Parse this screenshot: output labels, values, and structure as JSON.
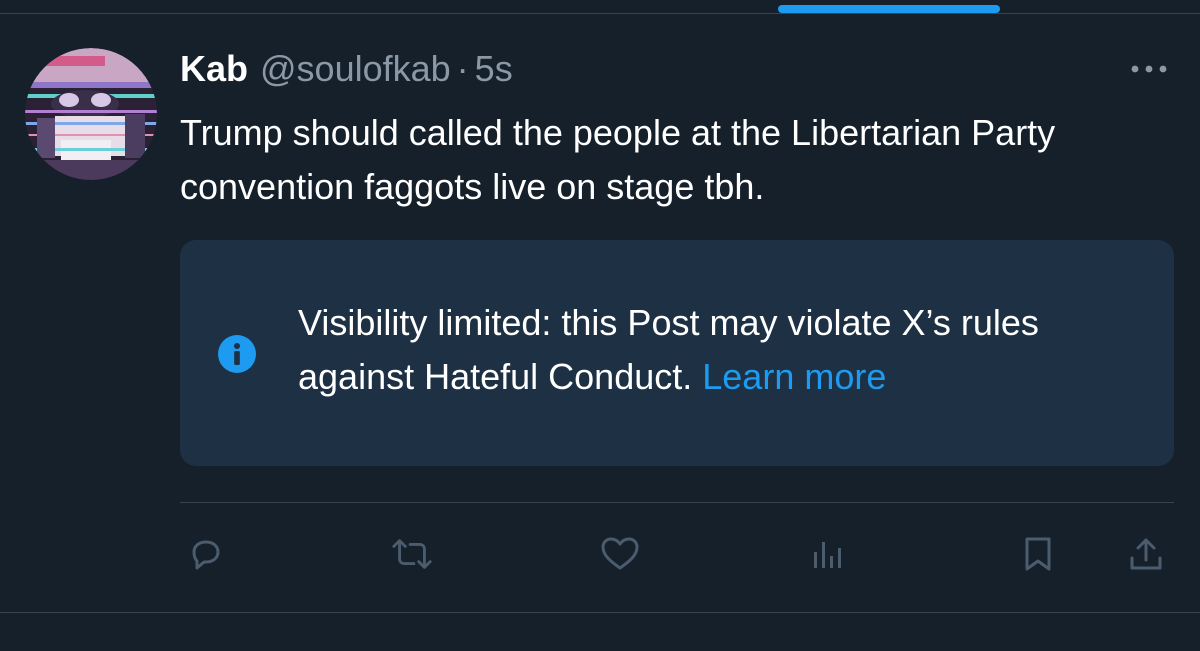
{
  "tweet": {
    "author_name": "Kab",
    "handle": "@soulofkab",
    "separator": "·",
    "time": "5s",
    "text": "Trump should called the people at the Libertarian Party convention faggots live on stage tbh."
  },
  "notice": {
    "text": "Visibility limited: this Post may violate X’s rules against Hateful Conduct.",
    "link_label": "Learn more",
    "icon": "info-icon"
  },
  "actions": {
    "reply_icon": "reply-icon",
    "repost_icon": "repost-icon",
    "like_icon": "like-icon",
    "views_icon": "views-icon",
    "bookmark_icon": "bookmark-icon",
    "share_icon": "share-icon",
    "more_icon": "more-icon"
  },
  "colors": {
    "background": "#15202b",
    "accent": "#1d9bf0",
    "muted": "#8b98a5",
    "notice_bg": "#1e3043",
    "divider": "#38444d"
  }
}
